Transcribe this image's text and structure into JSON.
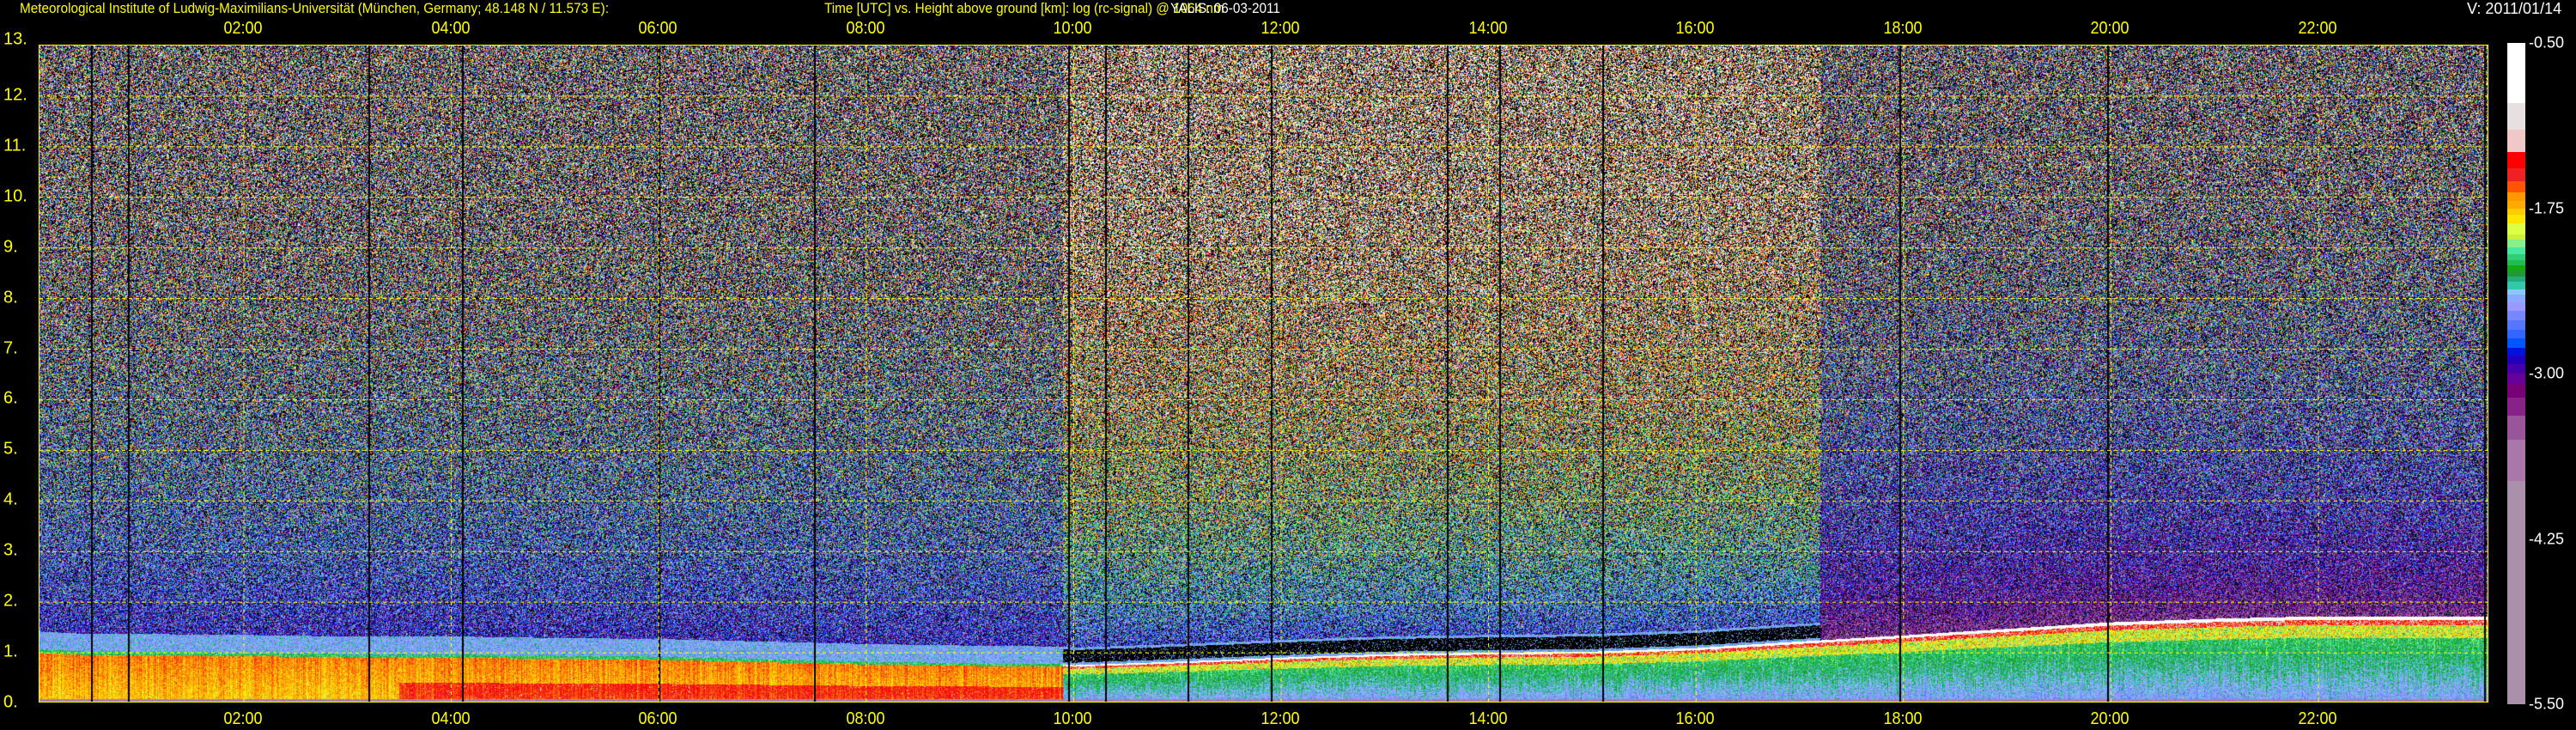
{
  "header": {
    "institute": "Meteorological Institute of Ludwig-Maximilians-Universität (München, Germany; 48.148 N / 11.573 E):",
    "title": "Time [UTC] vs. Height above ground [km]: log (rc-signal) @ 1064 nm",
    "instrument_date": "YALIS: 06-03-2011",
    "version": "V: 2011/01/14"
  },
  "chart_data": {
    "type": "heatmap",
    "title": "Time [UTC] vs. Height above ground [km]: log (rc-signal) @ 1064 nm",
    "xlabel": "Time [UTC]",
    "ylabel": "Height above ground [km]",
    "xlim": [
      0.03,
      23.65
    ],
    "ylim": [
      0,
      13
    ],
    "x_ticks": [
      "02:00",
      "04:00",
      "06:00",
      "08:00",
      "10:00",
      "12:00",
      "14:00",
      "16:00",
      "18:00",
      "20:00",
      "22:00"
    ],
    "x_tick_hours": [
      2,
      4,
      6,
      8,
      10,
      12,
      14,
      16,
      18,
      20,
      22
    ],
    "y_ticks": [
      "0.",
      "1.",
      "2.",
      "3.",
      "4.",
      "5.",
      "6.",
      "7.",
      "8.",
      "9.",
      "10.",
      "11.",
      "12.",
      "13."
    ],
    "grid": true,
    "colorbar": {
      "range": [
        -5.5,
        -0.5
      ],
      "tick_labels": [
        "-0.50",
        "-1.75",
        "-3.00",
        "-4.25",
        "-5.50"
      ],
      "tick_values": [
        -0.5,
        -1.75,
        -3.0,
        -4.25,
        -5.5
      ],
      "colormap": [
        {
          "min": -0.955,
          "color": "#ffffff"
        },
        {
          "min": -1.156,
          "color": "#e8e0e0"
        },
        {
          "min": -1.325,
          "color": "#f0c8c8"
        },
        {
          "min": -1.448,
          "color": "#ff0000"
        },
        {
          "min": -1.546,
          "color": "#ee2222"
        },
        {
          "min": -1.63,
          "color": "#ff5500"
        },
        {
          "min": -1.695,
          "color": "#ff9900"
        },
        {
          "min": -1.753,
          "color": "#ffaa00"
        },
        {
          "min": -1.799,
          "color": "#ffcc00"
        },
        {
          "min": -1.864,
          "color": "#ffe600"
        },
        {
          "min": -1.948,
          "color": "#ddff44"
        },
        {
          "min": -1.987,
          "color": "#c8f040"
        },
        {
          "min": -2.046,
          "color": "#88f088"
        },
        {
          "min": -2.098,
          "color": "#44e8a0"
        },
        {
          "min": -2.143,
          "color": "#33cc77"
        },
        {
          "min": -2.182,
          "color": "#22bb55"
        },
        {
          "min": -2.221,
          "color": "#11aa11"
        },
        {
          "min": -2.266,
          "color": "#229933"
        },
        {
          "min": -2.305,
          "color": "#22aa88"
        },
        {
          "min": -2.364,
          "color": "#33c8a8"
        },
        {
          "min": -2.403,
          "color": "#88c8ff"
        },
        {
          "min": -2.461,
          "color": "#88aaff"
        },
        {
          "min": -2.526,
          "color": "#9999ff"
        },
        {
          "min": -2.598,
          "color": "#7788ff"
        },
        {
          "min": -2.669,
          "color": "#5577ff"
        },
        {
          "min": -2.734,
          "color": "#3366ff"
        },
        {
          "min": -2.805,
          "color": "#0055ff"
        },
        {
          "min": -2.864,
          "color": "#0011dd"
        },
        {
          "min": -2.929,
          "color": "#2200bb"
        },
        {
          "min": -3.0,
          "color": "#4400aa"
        },
        {
          "min": -3.078,
          "color": "#660099"
        },
        {
          "min": -3.182,
          "color": "#770077"
        },
        {
          "min": -3.318,
          "color": "#882288"
        },
        {
          "min": -3.5,
          "color": "#995599"
        },
        {
          "min": -3.812,
          "color": "#aa77aa"
        },
        {
          "min": -5.5,
          "color": "#aa90aa"
        }
      ]
    },
    "layer_top": {
      "hours": [
        0,
        0.5,
        1,
        2,
        3,
        4,
        5,
        6,
        7,
        8,
        9,
        9.9,
        10,
        11,
        12,
        13,
        14,
        15,
        16,
        17,
        18,
        19,
        20,
        21,
        22,
        23,
        23.65
      ],
      "height_km": [
        1.05,
        1.0,
        1.0,
        0.98,
        0.95,
        0.95,
        0.92,
        0.9,
        0.85,
        0.8,
        0.77,
        0.75,
        0.73,
        0.8,
        0.88,
        0.95,
        0.98,
        1.0,
        1.07,
        1.2,
        1.32,
        1.45,
        1.58,
        1.65,
        1.7,
        1.7,
        1.7
      ]
    },
    "profile_gaps_utc": [
      0.53,
      0.88,
      3.2,
      4.1,
      6.0,
      7.5,
      9.95,
      10.3,
      11.1,
      11.9,
      13.6,
      14.1,
      15.1,
      17.96,
      19.96,
      23.6
    ]
  }
}
